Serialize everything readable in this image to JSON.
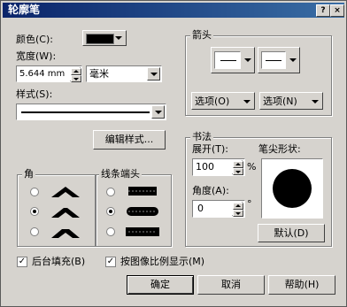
{
  "window": {
    "title": "轮廓笔",
    "help_glyph": "?",
    "close_glyph": "×"
  },
  "color": {
    "label": "颜色",
    "shortcut": "(C):",
    "value": "#000000"
  },
  "width": {
    "label": "宽度",
    "shortcut": "(W):",
    "value": "5.644 mm",
    "unit": "毫米"
  },
  "style": {
    "label": "样式",
    "shortcut": "(S):"
  },
  "edit_style_button": "编辑样式...",
  "arrows": {
    "title": "箭头",
    "options_left": "选项",
    "options_left_key": "(O)",
    "options_right": "选项",
    "options_right_key": "(N)"
  },
  "corners": {
    "title": "角",
    "selected_index": 1
  },
  "line_caps": {
    "title": "线条端头",
    "selected_index": 1
  },
  "calligraphy": {
    "title": "书法",
    "stretch_label": "展开",
    "stretch_key": "(T):",
    "stretch_value": "100",
    "stretch_unit": "%",
    "angle_label": "角度",
    "angle_key": "(A):",
    "angle_value": "0",
    "angle_unit": "°",
    "nib_label": "笔尖形状:",
    "default_button": "默认",
    "default_key": "(D)"
  },
  "behind_fill": {
    "label": "后台填充",
    "key": "(B)",
    "checked": true
  },
  "scale_with_image": {
    "label": "按图像比例显示",
    "key": "(M)",
    "checked": true
  },
  "buttons": {
    "ok": "确定",
    "cancel": "取消",
    "help": "帮助",
    "help_key": "(H)"
  }
}
